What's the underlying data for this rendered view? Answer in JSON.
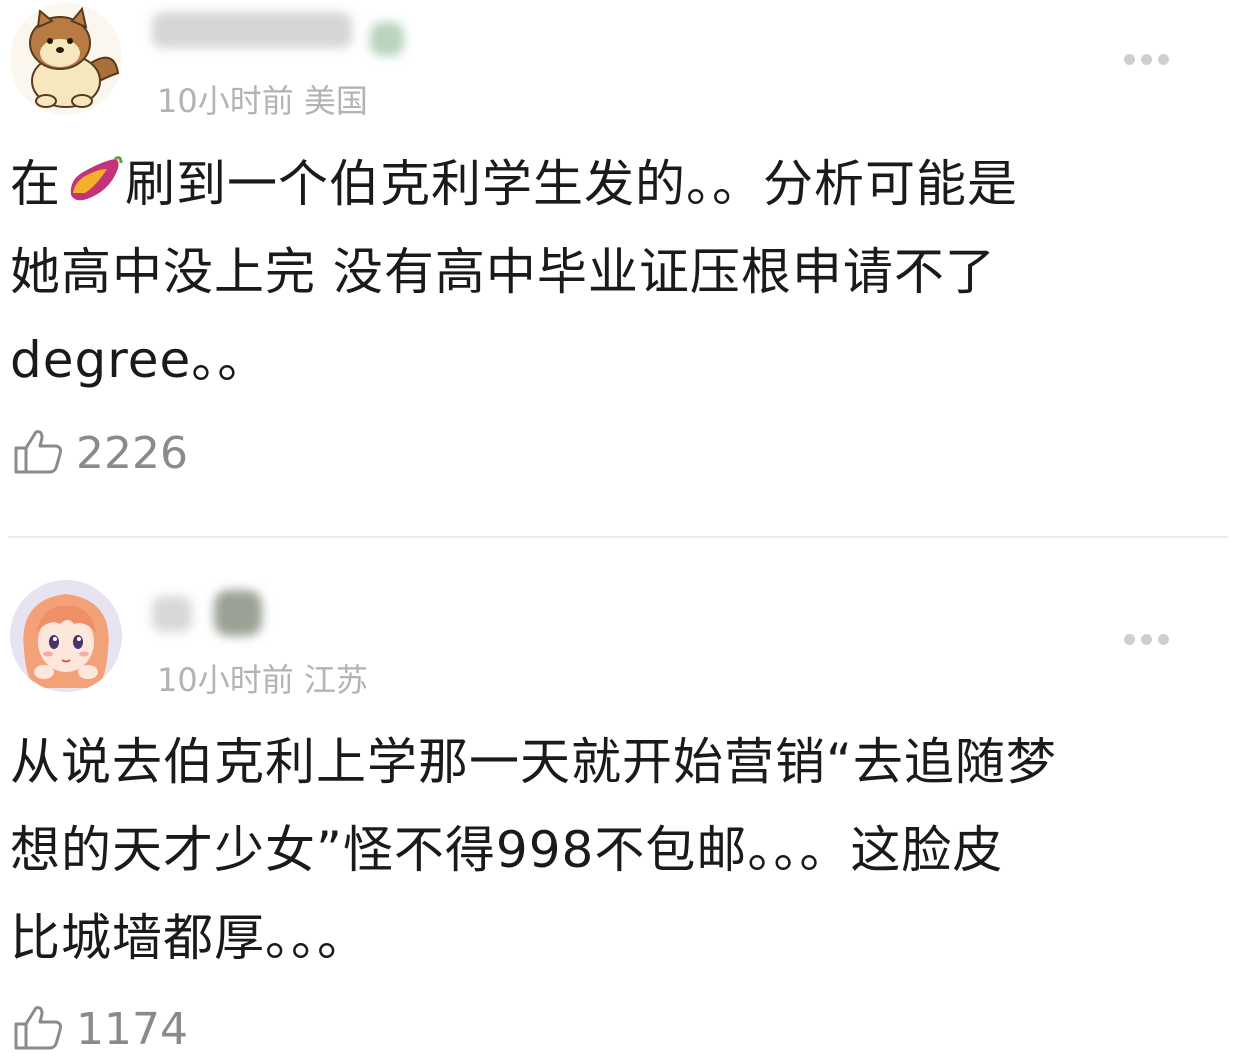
{
  "comments": [
    {
      "time": "10小时前",
      "location": "美国",
      "text_line1_pre": "在",
      "text_line1_post": "刷到一个伯克利学生发的。。分析可能是",
      "text_line2": "她高中没上完 没有高中毕业证压根申请不了",
      "text_line3": "degree。。",
      "likes": "2226"
    },
    {
      "time": "10小时前",
      "location": "江苏",
      "text_line1": "从说去伯克利上学那一天就开始营销“去追随梦",
      "text_line2": "想的天才少女”怪不得998不包邮。。。这脸皮",
      "text_line3": "比城墙都厚。。。",
      "likes": "1174"
    }
  ],
  "icons": {
    "avatar1": "dog-avatar-icon",
    "avatar2": "anime-girl-avatar-icon",
    "emoji": "sweet-potato-icon",
    "like": "thumbs-up-icon",
    "more": "more-dots-icon"
  },
  "colors": {
    "text": "#1a1a1a",
    "meta": "#b3b3b3",
    "like": "#8a8a8a",
    "divider": "#ececec"
  }
}
